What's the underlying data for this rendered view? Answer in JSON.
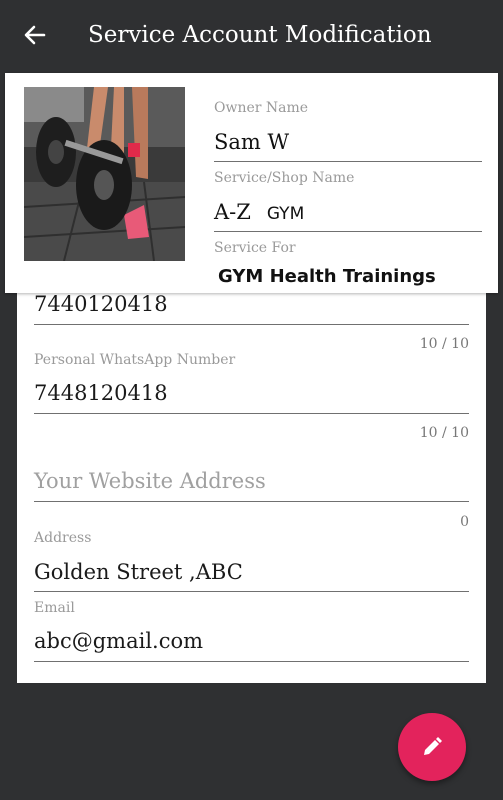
{
  "appbar": {
    "title": "Service Account Modification",
    "back_icon": "arrow-left-icon"
  },
  "profile": {
    "owner_label": "Owner Name",
    "owner_value": "Sam W",
    "shop_label": "Service/Shop Name",
    "shop_value_a": "A-Z",
    "shop_value_b": "GYM",
    "service_for_label": "Service For",
    "service_for_value": "GYM Health Trainings"
  },
  "form": {
    "phone_value": "7440120418",
    "phone_counter": "10 / 10",
    "whatsapp_label": "Personal WhatsApp Number",
    "whatsapp_value": "7448120418",
    "whatsapp_counter": "10 / 10",
    "website_placeholder": "Your Website Address",
    "website_counter": "0",
    "address_label": "Address",
    "address_value": "Golden Street ,ABC",
    "email_label": "Email",
    "email_value": "abc@gmail.com"
  },
  "fab": {
    "icon": "pencil-icon",
    "color": "#e3235c"
  },
  "colors": {
    "background": "#2f3032",
    "card": "#ffffff",
    "accent": "#e3235c"
  }
}
